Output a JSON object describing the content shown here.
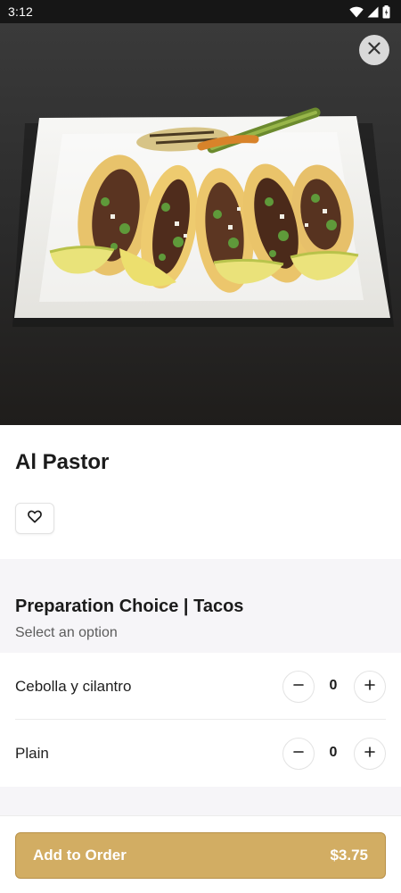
{
  "status_bar": {
    "time": "3:12",
    "icons": [
      "wifi-icon",
      "signal-icon",
      "battery-icon"
    ]
  },
  "hero": {
    "image": "tacos-al-pastor-photo",
    "close_icon": "close-icon"
  },
  "item": {
    "title": "Al Pastor",
    "favorite_icon": "heart-icon"
  },
  "option_group": {
    "title": "Preparation Choice | Tacos",
    "subtitle": "Select an option",
    "options": [
      {
        "label": "Cebolla y cilantro",
        "quantity": "0"
      },
      {
        "label": "Plain",
        "quantity": "0"
      }
    ]
  },
  "footer": {
    "add_label": "Add to Order",
    "price": "$3.75"
  },
  "colors": {
    "accent": "#d2ad63",
    "status_bar": "#161616",
    "section_bg": "#f6f5f8"
  }
}
